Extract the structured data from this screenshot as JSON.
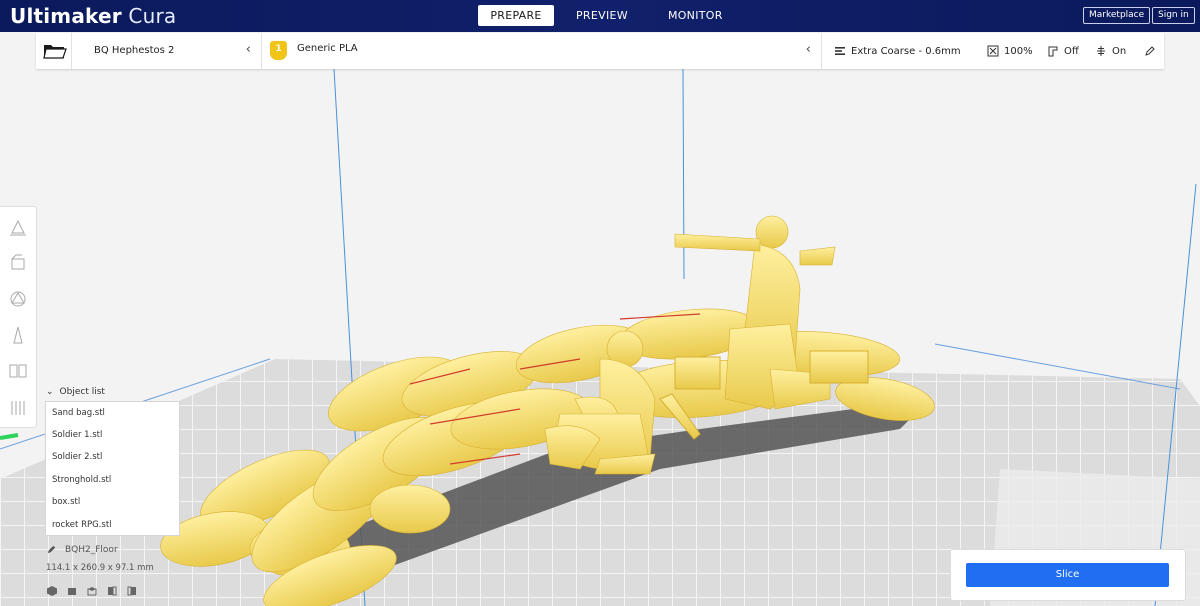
{
  "brand": {
    "name_bold": "Ultimaker",
    "name_light": "Cura"
  },
  "tabs": [
    {
      "label": "PREPARE",
      "active": true
    },
    {
      "label": "PREVIEW",
      "active": false
    },
    {
      "label": "MONITOR",
      "active": false
    }
  ],
  "top_buttons": {
    "marketplace": "Marketplace",
    "sign_in": "Sign in"
  },
  "header": {
    "printer": "BQ Hephestos 2",
    "material_badge": "1",
    "material": "Generic PLA",
    "profile": "Extra Coarse - 0.6mm",
    "infill": "100%",
    "support": "Off",
    "adhesion": "On"
  },
  "object_list": {
    "title": "Object list",
    "items": [
      "Sand bag.stl",
      "Soldier 1.stl",
      "Soldier 2.stl",
      "Stronghold.stl",
      "box.stl",
      "rocket RPG.stl"
    ]
  },
  "build_plate": {
    "name": "BQH2_Floor",
    "dimensions": "114.1 x 260.9 x 97.1 mm"
  },
  "slice_button": "Slice",
  "colors": {
    "topbar": "#0b1a5c",
    "accent": "#206ef2",
    "model": "#f5df75",
    "material_badge": "#f0c419"
  }
}
